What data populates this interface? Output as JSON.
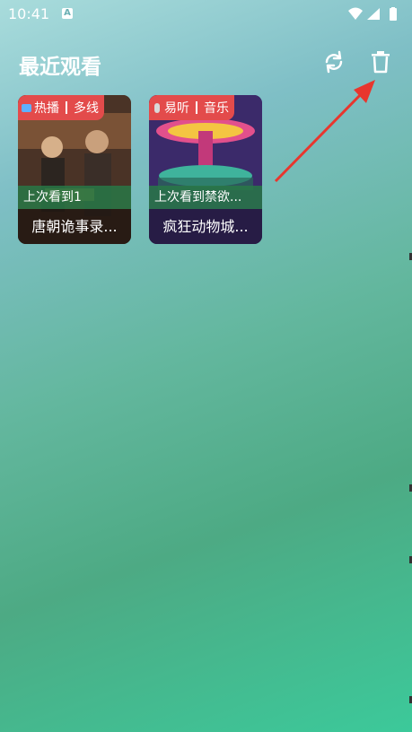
{
  "status": {
    "time": "10:41",
    "a_icon": "A"
  },
  "header": {
    "title": "最近观看",
    "sync_icon": "sync-icon",
    "delete_icon": "trash-icon"
  },
  "cards": [
    {
      "tag_left": "热播",
      "tag_right": "多线",
      "progress": "上次看到1",
      "title": "唐朝诡事录..."
    },
    {
      "tag_left": "易听",
      "tag_right": "音乐",
      "progress": "上次看到禁欲...",
      "title": "疯狂动物城..."
    }
  ],
  "colors": {
    "accent_red": "#e34b4b",
    "arrow_red": "#e8362e"
  }
}
